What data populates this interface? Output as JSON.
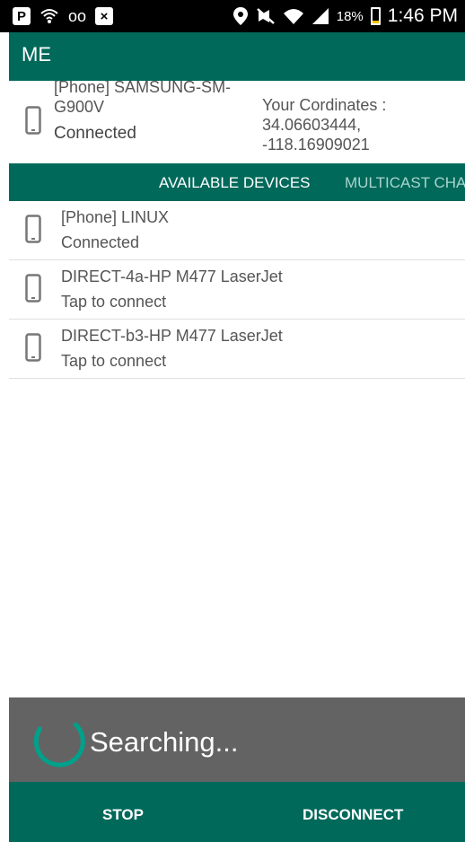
{
  "status_bar": {
    "left_icons": [
      "p-box-icon",
      "wifi-call-icon",
      "voicemail-icon",
      "x-box-icon"
    ],
    "p_glyph": "P",
    "voicemail_glyph": "oo",
    "x_glyph": "×",
    "right_icons": [
      "location-icon",
      "mute-icon",
      "wifi-icon",
      "signal-icon",
      "battery-icon"
    ],
    "battery_percent": "18%",
    "battery_level": 0.18,
    "time": "1:46 PM"
  },
  "app_bar": {
    "title": "ME"
  },
  "me_panel": {
    "device_name": "[Phone] SAMSUNG-SM-G900V",
    "status": "Connected",
    "coords_label": "Your Cordinates :",
    "latitude": "34.06603444,",
    "longitude": "-118.16909021",
    "icon": "phone-icon"
  },
  "tabs": [
    {
      "label": "AVAILABLE DEVICES",
      "selected": true
    },
    {
      "label": "MULTICAST CHAT",
      "selected": false
    }
  ],
  "devices": [
    {
      "name": "[Phone] LINUX",
      "status": "Connected",
      "icon": "phone-icon"
    },
    {
      "name": "DIRECT-4a-HP M477 LaserJet",
      "status": "Tap to connect",
      "icon": "phone-icon"
    },
    {
      "name": "DIRECT-b3-HP M477 LaserJet",
      "status": "Tap to connect",
      "icon": "phone-icon"
    }
  ],
  "searching": {
    "text": "Searching...",
    "icon": "spinner-icon"
  },
  "buttons": {
    "stop": "STOP",
    "disconnect": "DISCONNECT"
  },
  "colors": {
    "primary": "#00695a",
    "tab_inactive": "#a8d4cd",
    "spinner": "#00a08a",
    "searching_bg": "#636363",
    "battery_fill": "#f2c200"
  }
}
